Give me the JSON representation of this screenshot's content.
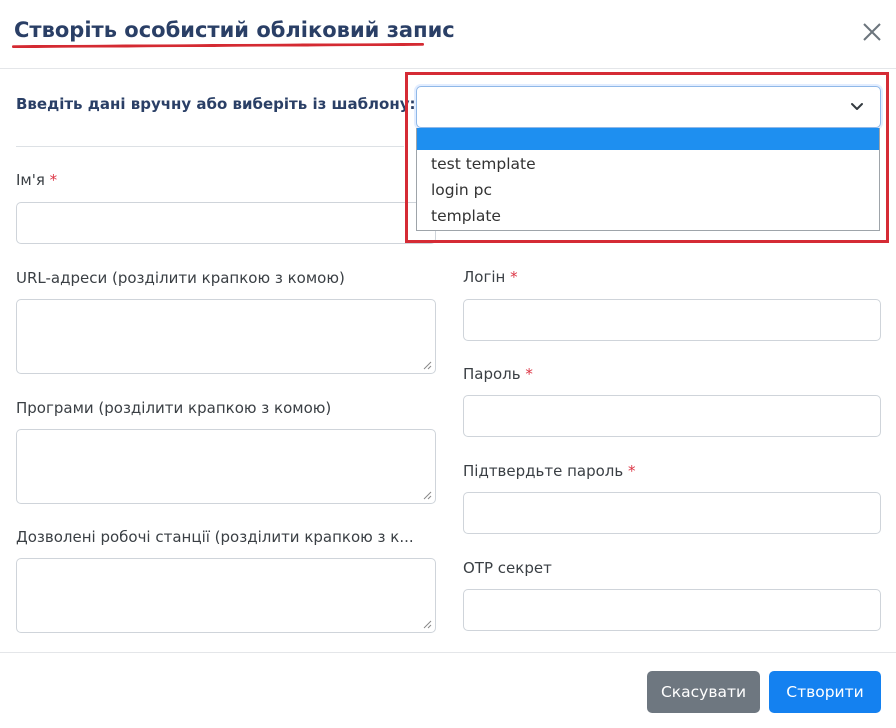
{
  "modal": {
    "title": "Створіть особистий обліковий запис"
  },
  "template": {
    "label": "Введіть дані вручну або виберіть із шаблону:",
    "selected": "",
    "options": [
      "",
      "test template",
      "login pc",
      "template"
    ]
  },
  "form": {
    "name_label": "Ім'я",
    "urls_label": "URL-адреси (розділити крапкою з комою)",
    "apps_label": "Програми (розділити крапкою з комою)",
    "workstations_label": "Дозволені робочі станції (розділити крапкою з к...",
    "login_label": "Логін",
    "password_label": "Пароль",
    "confirm_password_label": "Підтвердьте пароль",
    "otp_label": "OTP секрет",
    "required_mark": "*"
  },
  "footer": {
    "cancel_label": "Скасувати",
    "create_label": "Створити"
  },
  "colors": {
    "title": "#2a3f66",
    "annotation": "#d42a32",
    "primary": "#1481f0",
    "secondary": "#6e7780",
    "highlight": "#1e8ff0"
  }
}
